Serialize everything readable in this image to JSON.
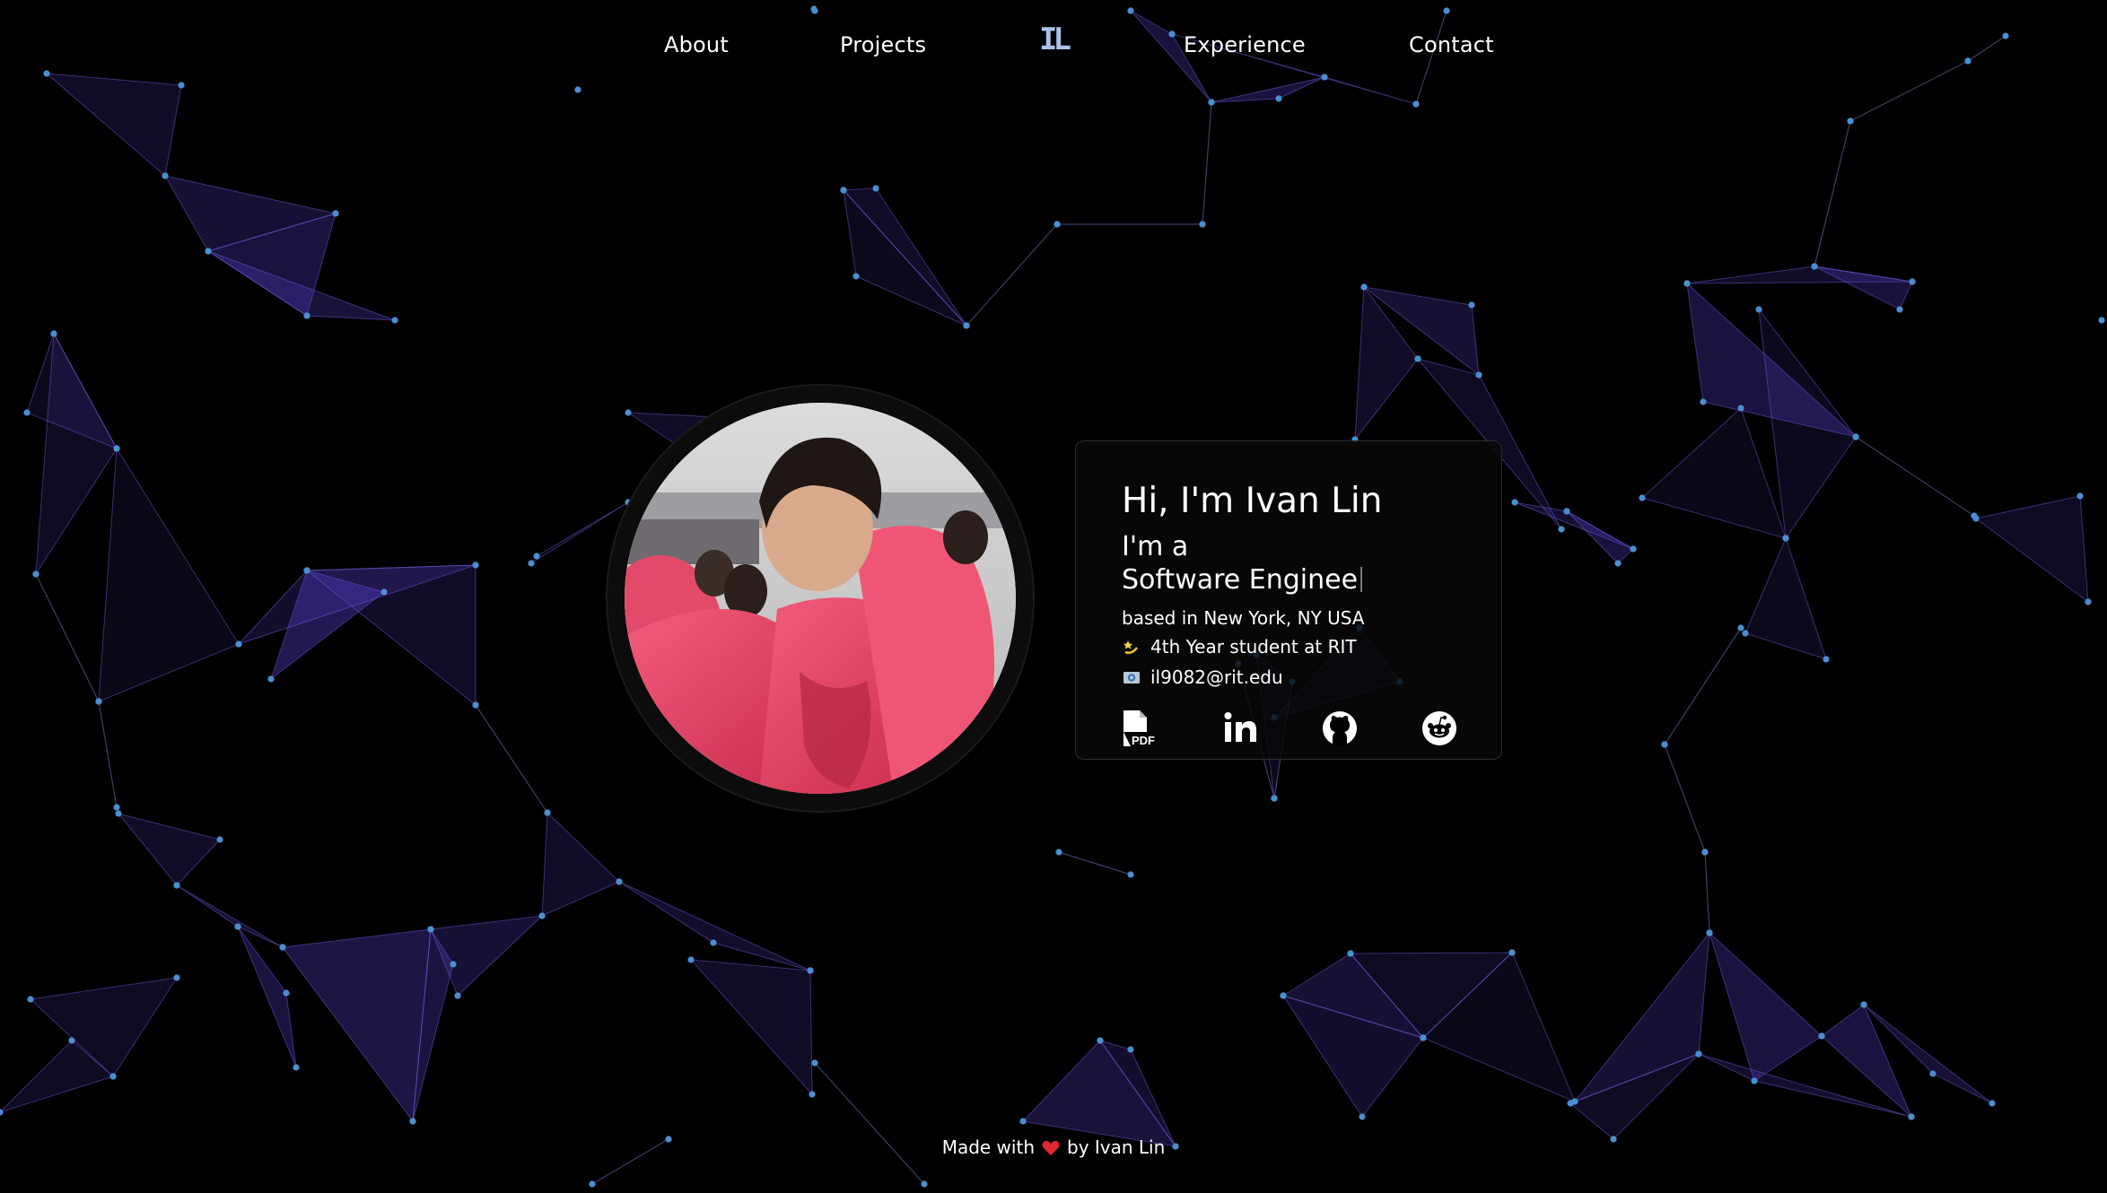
{
  "nav": {
    "links": [
      {
        "label": "About"
      },
      {
        "label": "Projects"
      },
      {
        "label": "Experience"
      },
      {
        "label": "Contact"
      }
    ],
    "logo": "IL"
  },
  "profile": {
    "greeting": "Hi, I'm Ivan Lin",
    "intro": "I'm a",
    "typed_role": "Software Enginee",
    "location": "based in New York, NY USA",
    "student": "4th Year student at RIT",
    "email": "il9082@rit.edu"
  },
  "socials": {
    "icons": [
      "pdf-resume-icon",
      "linkedin-icon",
      "github-icon",
      "reddit-icon"
    ]
  },
  "footer": {
    "prefix": "Made with",
    "suffix": "by Ivan Lin"
  },
  "colors": {
    "background": "#000000",
    "node": "#4a8fd0",
    "polygon": "#5b3fd0",
    "heart": "#e0282e",
    "logo": "#a9c2e8"
  }
}
